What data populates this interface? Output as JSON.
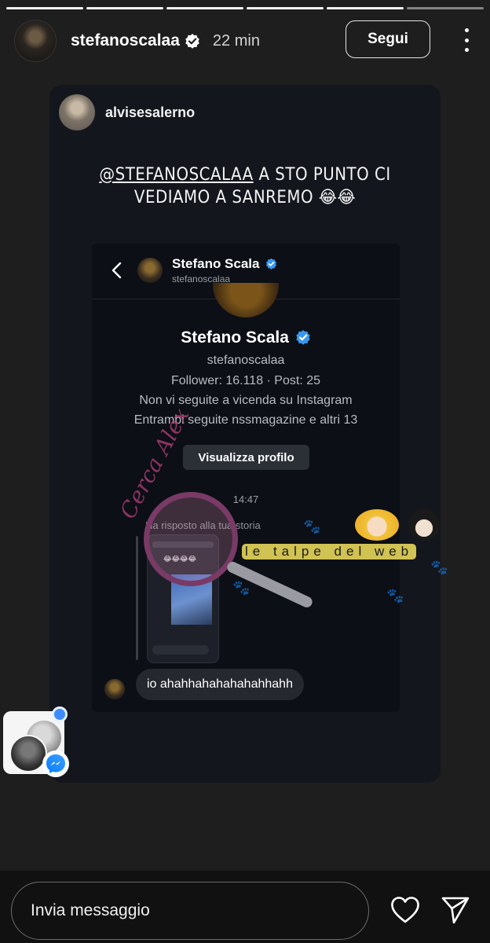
{
  "story": {
    "progress_total": 6,
    "progress_viewed": 5,
    "username": "stefanoscalaa",
    "time": "22 min",
    "follow_label": "Segui"
  },
  "card": {
    "username": "alvisesalerno",
    "mention": "@STEFANOSCALAA",
    "caption_rest": " A STO PUNTO CI",
    "caption_line2": "VEDIAMO A SANREMO 😂😂"
  },
  "dm": {
    "name": "Stefano Scala",
    "handle": "stefanoscalaa",
    "profile_name": "Stefano Scala",
    "profile_handle": "stefanoscalaa",
    "stats": "Follower: 16.118 · Post: 25",
    "line1": "Non vi seguite a vicenda su Instagram",
    "line2": "Entrambi seguite nssmagazine e altri 13",
    "view_profile_label": "Visualizza profilo",
    "time": "14:47",
    "replied_label": "Ha risposto alla tua storia",
    "story_emoji": "😂😂😂😂",
    "message": "io ahahhahahahahahhahh"
  },
  "watermark": {
    "script_text": "Cerca Alex",
    "banner_text": "le talpe del web"
  },
  "composer": {
    "placeholder": "Invia messaggio"
  },
  "colors": {
    "verified_blue": "#3897f0",
    "card_bg": "#13161d",
    "accent_dot": "#3d8bfd"
  }
}
